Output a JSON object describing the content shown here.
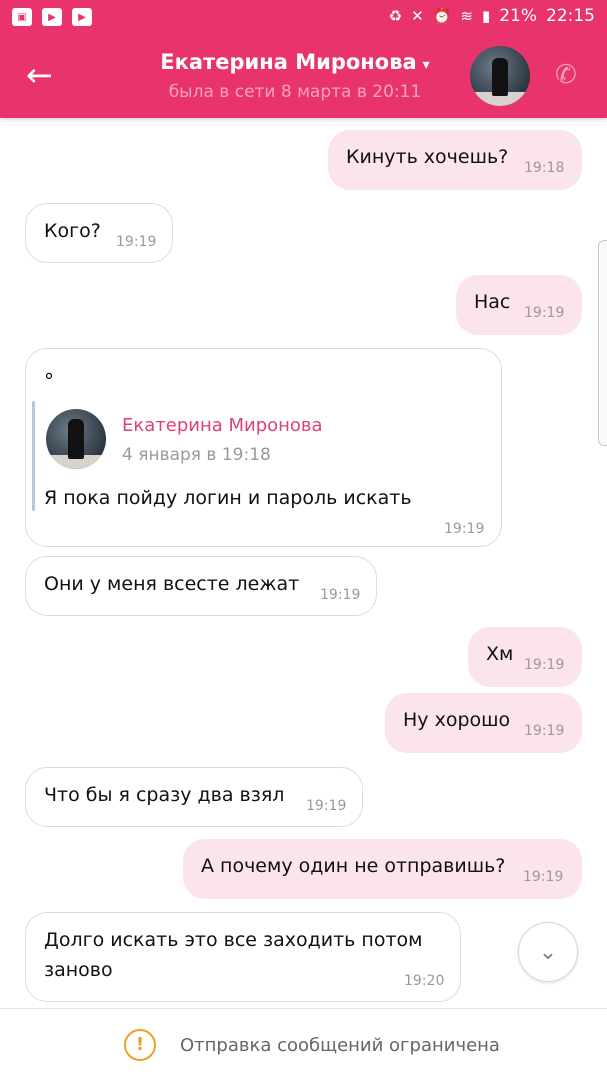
{
  "status_bar": {
    "battery": "21%",
    "time": "22:15",
    "left_icons": [
      "gallery-icon",
      "youtube-icon",
      "youtube-icon"
    ],
    "right_icons": [
      "battery-saver-icon",
      "mute-icon",
      "alarm-icon",
      "wifi-icon",
      "signal-icon"
    ]
  },
  "header": {
    "contact_name": "Екатерина Миронова",
    "last_seen": "была в сети 8 марта в 20:11",
    "back_icon": "arrow-left-icon",
    "call_icon": "phone-icon",
    "dropdown_icon": "chevron-down-icon"
  },
  "messages": [
    {
      "direction": "out",
      "text": "Кинуть хочешь?",
      "time": "19:18"
    },
    {
      "direction": "in",
      "text": "Кого?",
      "time": "19:19"
    },
    {
      "direction": "out",
      "text": "Нас",
      "time": "19:19"
    },
    {
      "direction": "in",
      "text": "°",
      "time": "19:19",
      "forwarded": {
        "author": "Екатерина Миронова",
        "date": "4 января в 19:18",
        "text": "Я пока пойду логин и пароль искать"
      }
    },
    {
      "direction": "in",
      "text": "Они у меня всесте лежат",
      "time": "19:19"
    },
    {
      "direction": "out",
      "text": "Хм",
      "time": "19:19"
    },
    {
      "direction": "out",
      "text": "Ну хорошо",
      "time": "19:19"
    },
    {
      "direction": "in",
      "text": "Что бы я сразу два взял",
      "time": "19:19"
    },
    {
      "direction": "out",
      "text": "А почему один не отправишь?",
      "time": "19:19"
    },
    {
      "direction": "in",
      "text": "Долго искать это все заходить потом",
      "text2": "заново",
      "time": "19:20"
    }
  ],
  "footer": {
    "notice": "Отправка сообщений ограничена",
    "notice_icon": "warning-icon"
  },
  "colors": {
    "accent": "#e8336d",
    "outgoing_bubble": "#fbe4ea",
    "name_link": "#e0407a"
  }
}
